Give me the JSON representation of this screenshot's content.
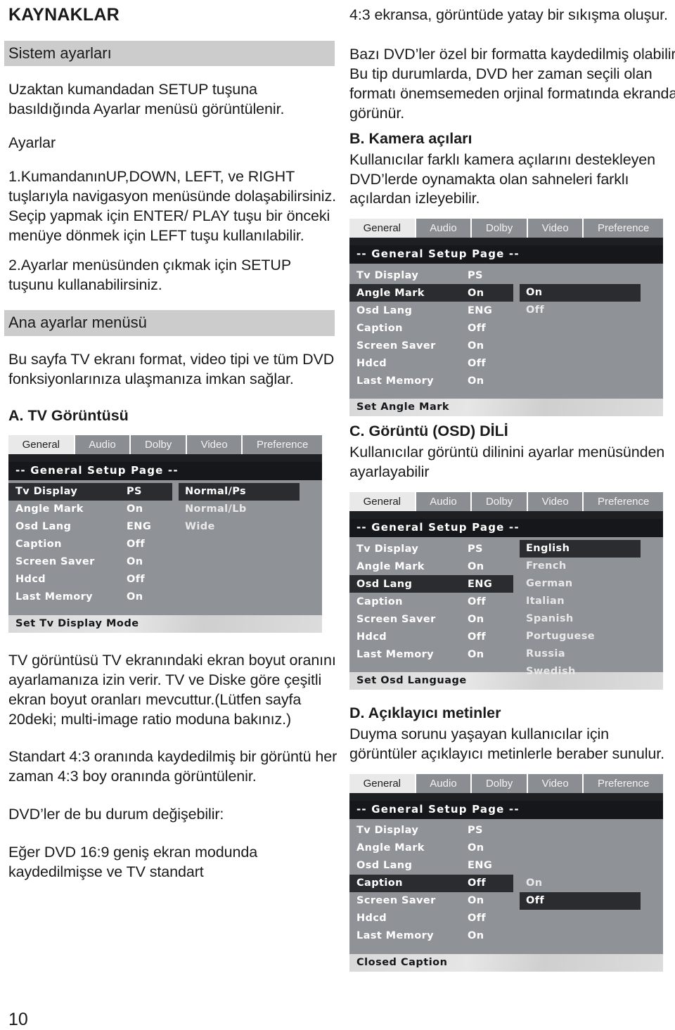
{
  "document": {
    "title": "KAYNAKLAR",
    "page_number": "10"
  },
  "left_column": {
    "section1_heading": "Sistem ayarları",
    "para1": "Uzaktan kumandadan SETUP tuşuna basıldığında Ayarlar menüsü görüntülenir.",
    "para2": "Ayarlar",
    "para3": "1.KumandanınUP,DOWN, LEFT, ve RIGHT tuşlarıyla navigasyon menüsünde dolaşabilirsiniz. Seçip yapmak için ENTER/ PLAY tuşu bir önceki menüye dönmek için LEFT tuşu kullanılabilir.",
    "para4": "2.Ayarlar menüsünden çıkmak için SETUP tuşunu kullanabilirsiniz.",
    "section2_heading": "Ana ayarlar menüsü",
    "para5": "Bu sayfa TV ekranı format, video tipi ve tüm DVD fonksiyonlarınıza ulaşmanıza imkan sağlar.",
    "sub_a_heading": "A. TV Görüntüsü",
    "para6": "TV görüntüsü TV ekranındaki ekran boyut oranını ayarlamanıza izin verir. TV ve Diske göre çeşitli ekran boyut oranları mevcuttur.(Lütfen sayfa 20deki; multi-image ratio moduna bakınız.)",
    "para7": "Standart 4:3 oranında kaydedilmiş bir görüntü her zaman 4:3 boy oranında görüntülenir.",
    "para8": "DVD’ler de bu durum değişebilir:",
    "para9": "Eğer DVD 16:9 geniş ekran modunda kaydedilmişse ve TV standart"
  },
  "right_column": {
    "para1": "4:3 ekransa, görüntüde yatay bir sıkışma oluşur.",
    "para2": "Bazı DVD’ler özel bir formatta kaydedilmiş olabilir. Bu tip durumlarda, DVD her zaman seçili olan formatı önemsemeden orjinal formatında ekranda görünür.",
    "sub_b_heading": "B. Kamera açıları",
    "para3": "Kullanıcılar farklı kamera açılarını destekleyen DVD’lerde oynamakta olan sahneleri farklı açılardan izleyebilir.",
    "sub_c_heading": "C. Görüntü (OSD) DİLİ",
    "para4": "Kullanıcılar görüntü dilinini ayarlar menüsünden ayarlayabilir",
    "sub_d_heading": "D. Açıklayıcı metinler",
    "para5": "Duyma sorunu yaşayan kullanıcılar için görüntüler açıklayıcı metinlerle beraber sunulur."
  },
  "osd_common": {
    "tabs": [
      "General",
      "Audio",
      "Dolby",
      "Video",
      "Preference"
    ],
    "selected_tab": "General",
    "page_title": "-- General Setup Page --",
    "row_labels": [
      "Tv Display",
      "Angle Mark",
      "Osd Lang",
      "Caption",
      "Screen Saver",
      "Hdcd",
      "Last Memory"
    ],
    "row_values": [
      "PS",
      "On",
      "ENG",
      "Off",
      "On",
      "Off",
      "On"
    ]
  },
  "osd_screens": [
    {
      "id": "tv-display",
      "highlight_row_index": 0,
      "options": [
        "Normal/Ps",
        "Normal/Lb",
        "Wide"
      ],
      "selected_option_index": 0,
      "options_offset_rows": 0,
      "status": "Set Tv Display Mode"
    },
    {
      "id": "angle-mark",
      "highlight_row_index": 1,
      "options": [
        "On",
        "Off"
      ],
      "selected_option_index": 0,
      "options_offset_rows": 1,
      "status": "Set Angle Mark"
    },
    {
      "id": "osd-language",
      "highlight_row_index": 2,
      "options": [
        "English",
        "French",
        "German",
        "Italian",
        "Spanish",
        "Portuguese",
        "Russia",
        "Swedish"
      ],
      "selected_option_index": 0,
      "options_offset_rows": 0,
      "status": "Set Osd Language"
    },
    {
      "id": "closed-caption",
      "highlight_row_index": 3,
      "options": [
        "On",
        "Off"
      ],
      "selected_option_index": 1,
      "options_offset_rows": 3,
      "status": "Closed Caption"
    }
  ]
}
